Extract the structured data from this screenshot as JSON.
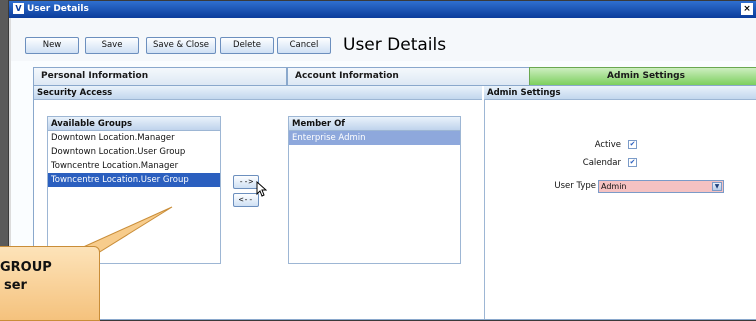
{
  "window": {
    "title": "User Details",
    "app_icon": "V",
    "close_glyph": "×"
  },
  "toolbar": {
    "new_label": "New",
    "save_label": "Save",
    "save_close_label": "Save & Close",
    "delete_label": "Delete",
    "cancel_label": "Cancel",
    "page_title": "User Details"
  },
  "tabs": [
    {
      "label": "Personal Information",
      "active": false
    },
    {
      "label": "Account Information",
      "active": false
    },
    {
      "label": "Admin Settings",
      "active": true
    }
  ],
  "security": {
    "header": "Security Access",
    "available": {
      "header": "Available Groups",
      "items": [
        "Downtown Location.Manager",
        "Downtown Location.User Group",
        "Towncentre Location.Manager",
        "Towncentre Location.User Group"
      ],
      "selected_index": 3
    },
    "move_right_label": "-->",
    "move_left_label": "<--",
    "member_of": {
      "header": "Member Of",
      "items": [
        "Enterprise Admin"
      ]
    }
  },
  "admin": {
    "header": "Admin Settings",
    "active_label": "Active",
    "active_checked": true,
    "calendar_label": "Calendar",
    "calendar_checked": true,
    "user_type_label": "User Type",
    "user_type_value": "Admin"
  },
  "callout": {
    "line1": "GROUP",
    "line2": "ser"
  },
  "colors": {
    "active_tab": "#7ccf5e",
    "selection": "#2b5fbf",
    "user_type_bg": "#f5c2c2"
  }
}
